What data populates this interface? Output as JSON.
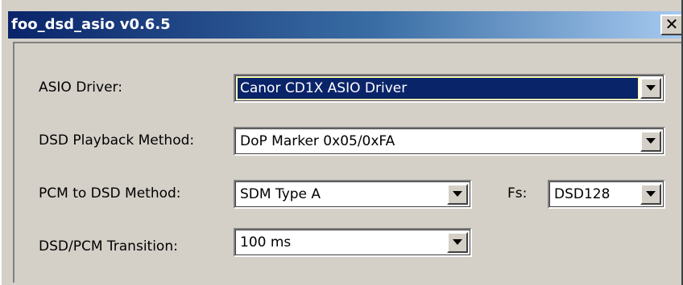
{
  "window": {
    "title": "foo_dsd_asio v0.6.5",
    "close_glyph": "✕"
  },
  "fields": {
    "asio_driver": {
      "label": "ASIO Driver:",
      "value": "Canor CD1X ASIO Driver",
      "focused": true
    },
    "dsd_playback_method": {
      "label": "DSD Playback Method:",
      "value": "DoP Marker 0x05/0xFA"
    },
    "pcm_to_dsd_method": {
      "label": "PCM to DSD Method:",
      "value": "SDM Type A"
    },
    "fs": {
      "label": "Fs:",
      "value": "DSD128"
    },
    "dsd_pcm_transition": {
      "label": "DSD/PCM Transition:",
      "value": "100 ms"
    }
  },
  "icons": {
    "dropdown": "chevron-down-icon",
    "close": "close-icon"
  },
  "colors": {
    "titlebar_start": "#0a246a",
    "titlebar_end": "#a6caf0",
    "face": "#d4d0c8",
    "selection": "#0a246a"
  }
}
